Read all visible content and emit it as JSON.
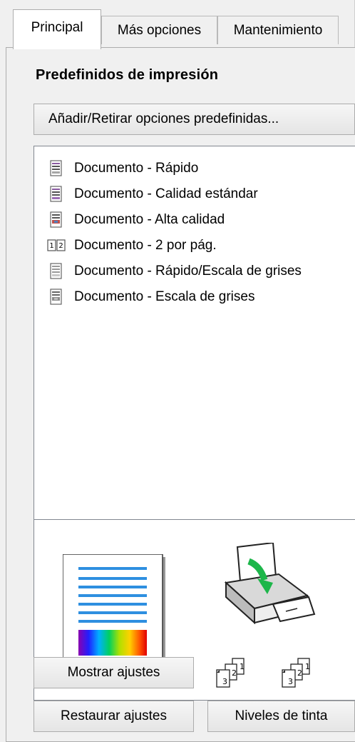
{
  "tabs": [
    {
      "label": "Principal",
      "active": true
    },
    {
      "label": "Más opciones",
      "active": false
    },
    {
      "label": "Mantenimiento",
      "active": false
    }
  ],
  "presets_heading": "Predefinidos de impresión",
  "add_remove_button": "Añadir/Retirar opciones predefinidas...",
  "presets": [
    {
      "label": "Documento - Rápido",
      "icon": "document-fast-icon"
    },
    {
      "label": "Documento - Calidad estándar",
      "icon": "document-standard-icon"
    },
    {
      "label": "Documento - Alta calidad",
      "icon": "document-high-quality-icon"
    },
    {
      "label": "Documento - 2 por pág.",
      "icon": "two-pages-per-sheet-icon"
    },
    {
      "label": "Documento - Rápido/Escala de grises",
      "icon": "document-fast-grayscale-icon"
    },
    {
      "label": "Documento - Escala de grises",
      "icon": "document-grayscale-icon"
    }
  ],
  "preview": {
    "page_icon": "color-document-preview-icon",
    "printer_icon": "printer-paper-feed-icon",
    "collate_icons": [
      {
        "digits": [
          "3",
          "2",
          "1"
        ]
      },
      {
        "digits": [
          "3",
          "2",
          "1"
        ]
      }
    ]
  },
  "show_settings_button": "Mostrar ajustes",
  "restore_settings_button": "Restaurar ajustes",
  "ink_levels_button": "Niveles de tinta"
}
